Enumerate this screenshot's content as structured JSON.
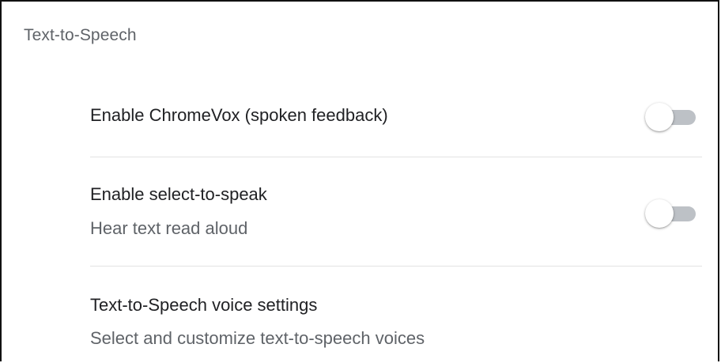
{
  "section": {
    "title": "Text-to-Speech"
  },
  "settings": [
    {
      "label": "Enable ChromeVox (spoken feedback)",
      "control": "toggle",
      "checked": false
    },
    {
      "label": "Enable select-to-speak",
      "sublabel": "Hear text read aloud",
      "control": "toggle",
      "checked": false
    },
    {
      "label": "Text-to-Speech voice settings",
      "sublabel": "Select and customize text-to-speech voices",
      "control": "link"
    }
  ],
  "colors": {
    "title": "#5f6368",
    "label": "#202124",
    "sublabel": "#5f6368",
    "toggle_track_off": "#bdc1c6",
    "toggle_knob": "#ffffff",
    "divider": "#e3e3e3"
  }
}
